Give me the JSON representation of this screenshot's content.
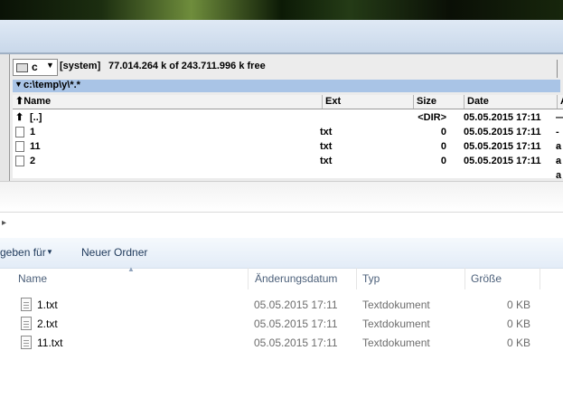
{
  "tc": {
    "drive_letter": "c",
    "drive_label": "[system]",
    "free_space": "77.014.264 k of 243.711.996 k free",
    "path": "c:\\temp\\y\\*.*",
    "columns": {
      "name": "Name",
      "ext": "Ext",
      "size": "Size",
      "date": "Date",
      "attr": "A"
    },
    "files": [
      {
        "name": "[..]",
        "ext": "",
        "size": "<DIR>",
        "date": "05.05.2015 17:11",
        "attr": "—"
      },
      {
        "name": "1",
        "ext": "txt",
        "size": "0",
        "date": "05.05.2015 17:11",
        "attr": "-a"
      },
      {
        "name": "11",
        "ext": "txt",
        "size": "0",
        "date": "05.05.2015 17:11",
        "attr": "-a"
      },
      {
        "name": "2",
        "ext": "txt",
        "size": "0",
        "date": "05.05.2015 17:11",
        "attr": "-a"
      }
    ]
  },
  "explorer": {
    "toolbar": {
      "share_label": "geben für",
      "new_folder_label": "Neuer Ordner"
    },
    "columns": {
      "name": "Name",
      "date": "Änderungsdatum",
      "type": "Typ",
      "size": "Größe"
    },
    "files": [
      {
        "name": "1.txt",
        "date": "05.05.2015 17:11",
        "type": "Textdokument",
        "size": "0 KB"
      },
      {
        "name": "2.txt",
        "date": "05.05.2015 17:11",
        "type": "Textdokument",
        "size": "0 KB"
      },
      {
        "name": "11.txt",
        "date": "05.05.2015 17:11",
        "type": "Textdokument",
        "size": "0 KB"
      }
    ]
  },
  "colors": {
    "path_bar": "#a9c4e6",
    "toolbar_text": "#1e395b",
    "secondary_text": "#6d6d6d"
  }
}
